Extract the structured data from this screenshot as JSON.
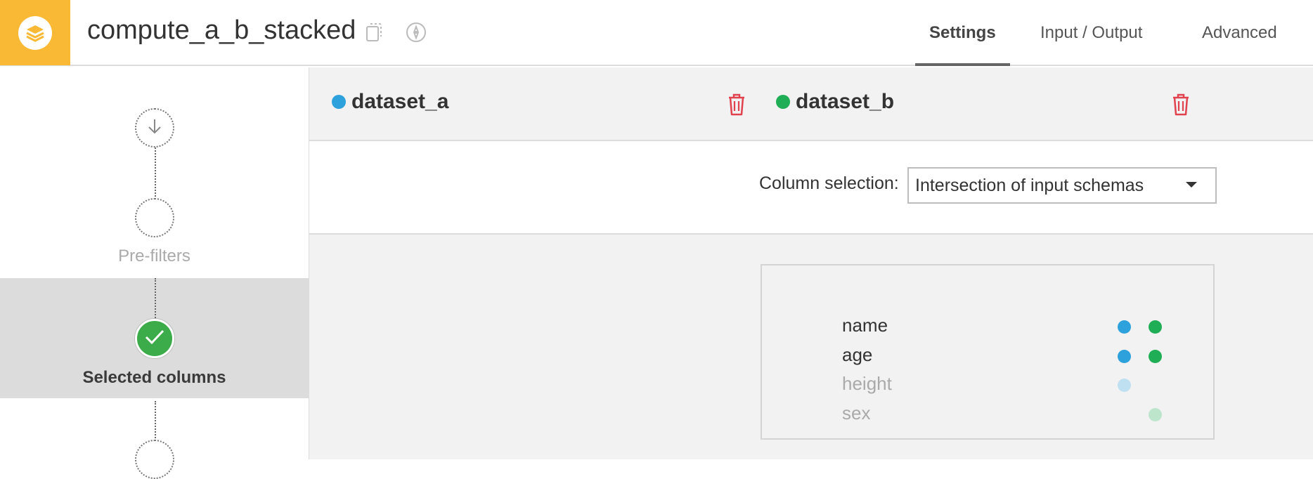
{
  "header": {
    "title": "compute_a_b_stacked",
    "tabs": [
      {
        "label": "Settings",
        "active": true
      },
      {
        "label": "Input / Output",
        "active": false
      },
      {
        "label": "Advanced",
        "active": false
      }
    ],
    "accent_color": "#f9b934"
  },
  "steps": {
    "items": [
      {
        "label": "",
        "state": "pending",
        "icon": "arrow-down-icon"
      },
      {
        "label": "Pre-filters",
        "state": "pending"
      },
      {
        "label": "Selected columns",
        "state": "done",
        "icon": "check-icon"
      },
      {
        "label": "",
        "state": "pending"
      }
    ],
    "active_index": 2
  },
  "datasets": [
    {
      "name": "dataset_a",
      "color": "#2ca1db"
    },
    {
      "name": "dataset_b",
      "color": "#1fae55"
    }
  ],
  "column_selection": {
    "label": "Column selection:",
    "value": "Intersection of input schemas"
  },
  "columns": [
    {
      "name": "name",
      "in_a": true,
      "in_b": true,
      "included": true
    },
    {
      "name": "age",
      "in_a": true,
      "in_b": true,
      "included": true
    },
    {
      "name": "height",
      "in_a": true,
      "in_b": false,
      "included": false
    },
    {
      "name": "sex",
      "in_a": false,
      "in_b": true,
      "included": false
    }
  ],
  "colors": {
    "dot_a": "#2ca1db",
    "dot_b": "#1fae55",
    "dot_a_muted": "#bfe0f1",
    "dot_b_muted": "#bde5cb",
    "trash": "#e0424f",
    "done": "#3cac4b"
  }
}
